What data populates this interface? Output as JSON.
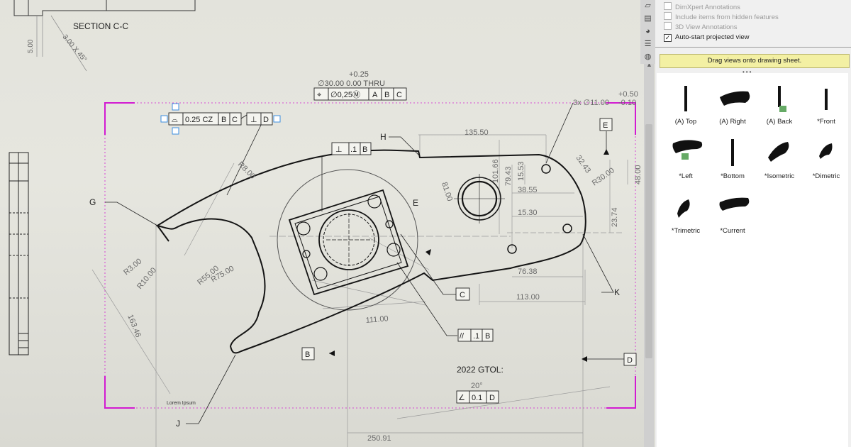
{
  "drawing": {
    "section_label": "SECTION C-C",
    "section_dims": [
      "5.00",
      "3.00 X 45°"
    ],
    "hole_callout": {
      "tolerance": "+0.25",
      "spec": "∅30.00 0.00 THRU",
      "frame": [
        "⌖",
        "∅0,25Ⓜ",
        "A",
        "B",
        "C"
      ]
    },
    "profile_frame": [
      "⌓",
      "0.25 CZ",
      "B",
      "C",
      "⊥",
      "D"
    ],
    "perp_frame": [
      "⊥",
      ".1",
      "B"
    ],
    "parallel_frame": [
      "//",
      ".1",
      "B"
    ],
    "angle_frame": [
      "∠",
      "0.1",
      "D"
    ],
    "angle_value": "20°",
    "gtol_title": "2022 GTOL:",
    "lorem": "Lorem Ipsum",
    "hole_pattern": "3x ∅11.00",
    "hole_tol": [
      "+0.50",
      "-0.10"
    ],
    "datums": [
      "E",
      "D",
      "C",
      "B"
    ],
    "leaders": [
      "G",
      "H",
      "E",
      "K",
      "J"
    ],
    "dimensions": {
      "d135": "135.50",
      "d101": "101.66",
      "d79": "79.43",
      "d15": "15.53",
      "d38": "38.55",
      "d15b": "15.30",
      "d32": "32.43",
      "dR30": "R30.00",
      "d48": "48.00",
      "d23": "23.74",
      "d76": "76.38",
      "d113": "113.00",
      "d81": "81.00",
      "d111": "111.00",
      "d250": "250.91",
      "dR3": "R3.00",
      "dR10": "R10.00",
      "dR55": "R55.00",
      "dR75": "R75.00",
      "dR8": "R8.00",
      "d163": "163.46"
    }
  },
  "right_panel": {
    "options": [
      {
        "label": "DimXpert Annotations",
        "checked": false
      },
      {
        "label": "Include items from hidden features",
        "checked": false
      },
      {
        "label": "3D View Annotations",
        "checked": false
      },
      {
        "label": "Auto-start projected view",
        "checked": true
      }
    ],
    "hint": "Drag views onto drawing sheet.",
    "views": [
      "(A) Top",
      "(A) Right",
      "(A) Back",
      "*Front",
      "*Left",
      "*Bottom",
      "*Isometric",
      "*Dimetric",
      "*Trimetric",
      "*Current"
    ]
  },
  "icons": [
    "sheet-icon",
    "property-icon",
    "appearance-icon",
    "view-palette-icon",
    "globe-icon",
    "checkbox-icon",
    "drag-grip-icon"
  ],
  "colors": {
    "boundary": "#d21ad2",
    "hint_bg": "#f3f0a3",
    "outline": "#141414",
    "dimension": "#6b6b6b",
    "panel_bg": "#f0f0f0"
  }
}
